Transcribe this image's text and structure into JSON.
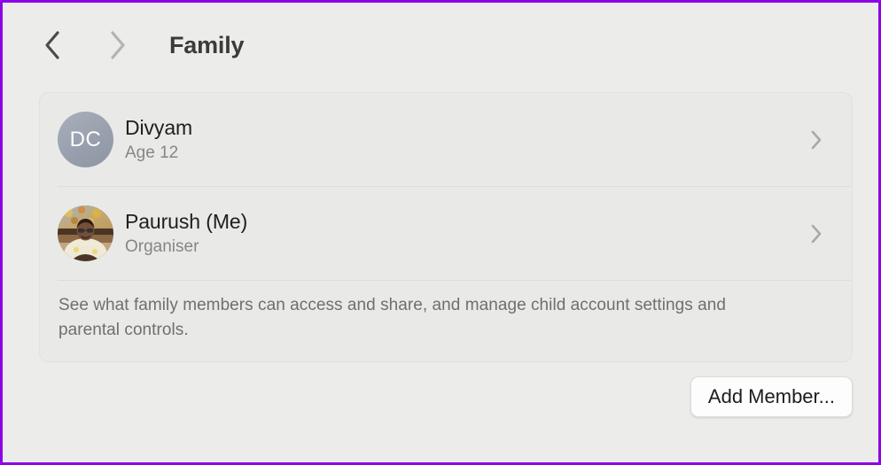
{
  "window": {
    "accent_border_color": "#8e00e6",
    "background_color": "#ececeb"
  },
  "toolbar": {
    "back_icon": "chevron-left-icon",
    "forward_icon": "chevron-right-icon",
    "title": "Family"
  },
  "card": {
    "members": [
      {
        "avatar_type": "initials",
        "initials": "DC",
        "name": "Divyam",
        "subtitle": "Age 12",
        "disclosure_icon": "chevron-right-icon"
      },
      {
        "avatar_type": "photo",
        "initials": "",
        "name": "Paurush (Me)",
        "subtitle": "Organiser",
        "disclosure_icon": "chevron-right-icon"
      }
    ],
    "footnote": "See what family members can access and share, and manage child account settings and parental controls."
  },
  "footer": {
    "add_member_label": "Add Member..."
  }
}
